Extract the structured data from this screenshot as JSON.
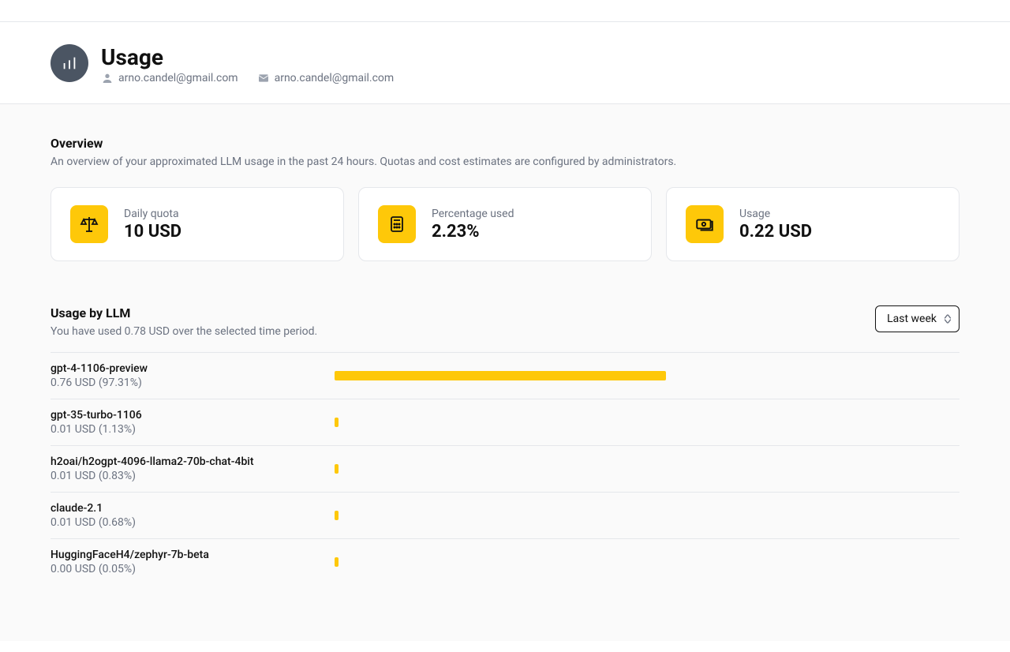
{
  "header": {
    "title": "Usage",
    "username": "arno.candel@gmail.com",
    "email": "arno.candel@gmail.com"
  },
  "overview": {
    "title": "Overview",
    "description": "An overview of your approximated LLM usage in the past 24 hours. Quotas and cost estimates are configured by administrators.",
    "cards": [
      {
        "label": "Daily quota",
        "value": "10 USD",
        "icon": "scale"
      },
      {
        "label": "Percentage used",
        "value": "2.23%",
        "icon": "calculator"
      },
      {
        "label": "Usage",
        "value": "0.22 USD",
        "icon": "money"
      }
    ]
  },
  "usage_by_llm": {
    "title": "Usage by LLM",
    "description": "You have used 0.78 USD over the selected time period.",
    "period": "Last week",
    "items": [
      {
        "name": "gpt-4-1106-preview",
        "sub": "0.76 USD (97.31%)",
        "pct": 97.31
      },
      {
        "name": "gpt-35-turbo-1106",
        "sub": "0.01 USD (1.13%)",
        "pct": 1.13
      },
      {
        "name": "h2oai/h2ogpt-4096-llama2-70b-chat-4bit",
        "sub": "0.01 USD (0.83%)",
        "pct": 0.83
      },
      {
        "name": "claude-2.1",
        "sub": "0.01 USD (0.68%)",
        "pct": 0.68
      },
      {
        "name": "HuggingFaceH4/zephyr-7b-beta",
        "sub": "0.00 USD (0.05%)",
        "pct": 0.05
      }
    ]
  },
  "chart_data": {
    "type": "bar",
    "orientation": "horizontal",
    "categories": [
      "gpt-4-1106-preview",
      "gpt-35-turbo-1106",
      "h2oai/h2ogpt-4096-llama2-70b-chat-4bit",
      "claude-2.1",
      "HuggingFaceH4/zephyr-7b-beta"
    ],
    "series": [
      {
        "name": "USD",
        "values": [
          0.76,
          0.01,
          0.01,
          0.01,
          0.0
        ]
      },
      {
        "name": "Percent",
        "values": [
          97.31,
          1.13,
          0.83,
          0.68,
          0.05
        ]
      }
    ],
    "title": "Usage by LLM",
    "xlabel": "",
    "ylabel": "",
    "xlim": [
      0,
      100
    ]
  },
  "colors": {
    "accent": "#fec809",
    "muted": "#6b7280",
    "border": "#e5e7eb",
    "bg_icon": "#4b5563"
  }
}
